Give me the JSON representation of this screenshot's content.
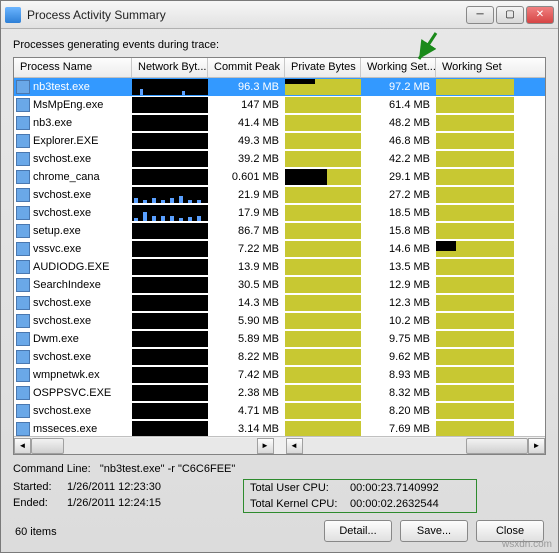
{
  "window": {
    "title": "Process Activity Summary"
  },
  "subtitle": "Processes generating events during trace:",
  "columns": [
    "Process Name",
    "Network Byt...",
    "Commit Peak",
    "Private Bytes",
    "Working Set...",
    "Working Set"
  ],
  "rows": [
    {
      "name": "nb3test.exe",
      "commit": "96.3 MB",
      "ws": "97.2 MB",
      "sel": true,
      "net": 1,
      "pb": "fullstep",
      "wsg": "full"
    },
    {
      "name": "MsMpEng.exe",
      "commit": "147 MB",
      "ws": "61.4 MB",
      "net": 0,
      "pb": "full",
      "wsg": "full"
    },
    {
      "name": "nb3.exe",
      "commit": "41.4 MB",
      "ws": "48.2 MB",
      "net": 0,
      "pb": "full",
      "wsg": "full"
    },
    {
      "name": "Explorer.EXE",
      "commit": "49.3 MB",
      "ws": "46.8 MB",
      "net": 0,
      "pb": "full",
      "wsg": "full"
    },
    {
      "name": "svchost.exe",
      "commit": "39.2 MB",
      "ws": "42.2 MB",
      "net": 0,
      "pb": "full",
      "wsg": "full"
    },
    {
      "name": "chrome_cana",
      "commit": "0.601 MB",
      "ws": "29.1 MB",
      "net": 0,
      "pb": "partial",
      "wsg": "full"
    },
    {
      "name": "svchost.exe",
      "commit": "21.9 MB",
      "ws": "27.2 MB",
      "net": 2,
      "pb": "full",
      "wsg": "full"
    },
    {
      "name": "svchost.exe",
      "commit": "17.9 MB",
      "ws": "18.5 MB",
      "net": 2,
      "pb": "full",
      "wsg": "full"
    },
    {
      "name": "setup.exe",
      "commit": "86.7 MB",
      "ws": "15.8 MB",
      "net": 0,
      "pb": "full",
      "wsg": "full"
    },
    {
      "name": "vssvc.exe",
      "commit": "7.22 MB",
      "ws": "14.6 MB",
      "net": 0,
      "pb": "full",
      "wsg": "step"
    },
    {
      "name": "AUDIODG.EXE",
      "commit": "13.9 MB",
      "ws": "13.5 MB",
      "net": 0,
      "pb": "full",
      "wsg": "full"
    },
    {
      "name": "SearchIndexe",
      "commit": "30.5 MB",
      "ws": "12.9 MB",
      "net": 0,
      "pb": "full",
      "wsg": "full"
    },
    {
      "name": "svchost.exe",
      "commit": "14.3 MB",
      "ws": "12.3 MB",
      "net": 0,
      "pb": "full",
      "wsg": "full"
    },
    {
      "name": "svchost.exe",
      "commit": "5.90 MB",
      "ws": "10.2 MB",
      "net": 0,
      "pb": "full",
      "wsg": "full"
    },
    {
      "name": "Dwm.exe",
      "commit": "5.89 MB",
      "ws": "9.75 MB",
      "net": 0,
      "pb": "full",
      "wsg": "full"
    },
    {
      "name": "svchost.exe",
      "commit": "8.22 MB",
      "ws": "9.62 MB",
      "net": 0,
      "pb": "full",
      "wsg": "full"
    },
    {
      "name": "wmpnetwk.ex",
      "commit": "7.42 MB",
      "ws": "8.93 MB",
      "net": 0,
      "pb": "full",
      "wsg": "full"
    },
    {
      "name": "OSPPSVC.EXE",
      "commit": "2.38 MB",
      "ws": "8.32 MB",
      "net": 0,
      "pb": "full",
      "wsg": "full"
    },
    {
      "name": "svchost.exe",
      "commit": "4.71 MB",
      "ws": "8.20 MB",
      "net": 0,
      "pb": "full",
      "wsg": "full"
    },
    {
      "name": "msseces.exe",
      "commit": "3.14 MB",
      "ws": "7.69 MB",
      "net": 0,
      "pb": "full",
      "wsg": "full"
    }
  ],
  "command_line_label": "Command Line:",
  "command_line_value": "\"nb3test.exe\" -r \"C6C6FEE\"",
  "started_label": "Started:",
  "started_value": "1/26/2011 12:23:30",
  "ended_label": "Ended:",
  "ended_value": "1/26/2011 12:24:15",
  "total_user_cpu_label": "Total User CPU:",
  "total_user_cpu_value": "00:00:23.7140992",
  "total_kernel_cpu_label": "Total Kernel CPU:",
  "total_kernel_cpu_value": "00:00:02.2632544",
  "item_count": "60 items",
  "buttons": {
    "detail": "Detail...",
    "save": "Save...",
    "close": "Close"
  },
  "watermark": "wsxdn.com"
}
